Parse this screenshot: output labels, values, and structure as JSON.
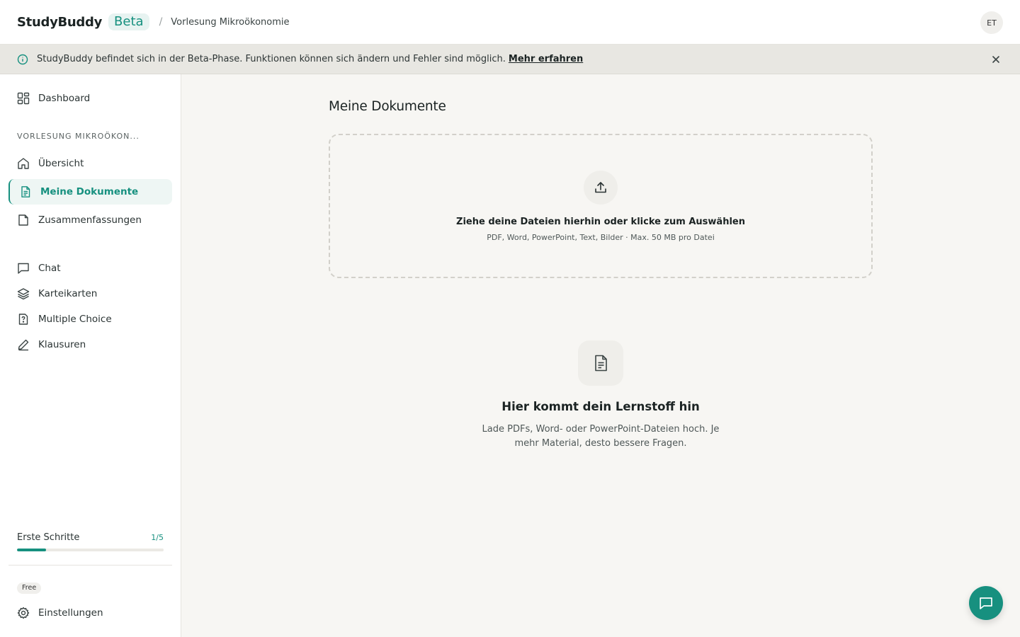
{
  "header": {
    "brand": "StudyBuddy",
    "beta": "Beta",
    "separator": "/",
    "breadcrumb": "Vorlesung Mikroökonomie",
    "avatar_initials": "ET"
  },
  "banner": {
    "text": "StudyBuddy befindet sich in der Beta-Phase. Funktionen können sich ändern und Fehler sind möglich.",
    "link": "Mehr erfahren"
  },
  "sidebar": {
    "dashboard": "Dashboard",
    "section_label": "VORLESUNG MIKROÖKON...",
    "items": [
      {
        "label": "Übersicht",
        "icon": "home-icon"
      },
      {
        "label": "Meine Dokumente",
        "icon": "document-icon",
        "active": true
      },
      {
        "label": "Zusammenfassungen",
        "icon": "file-icon"
      },
      {
        "label": "Chat",
        "icon": "chat-icon"
      },
      {
        "label": "Karteikarten",
        "icon": "layers-icon"
      },
      {
        "label": "Multiple Choice",
        "icon": "question-file-icon"
      },
      {
        "label": "Klausuren",
        "icon": "pencil-icon"
      }
    ],
    "progress": {
      "label": "Erste Schritte",
      "count": "1/5",
      "fraction": 0.2
    },
    "plan": "Free",
    "settings": "Einstellungen"
  },
  "main": {
    "title": "Meine Dokumente",
    "dropzone": {
      "title": "Ziehe deine Dateien hierhin oder klicke zum Auswählen",
      "subtitle": "PDF, Word, PowerPoint, Text, Bilder · Max. 50 MB pro Datei"
    },
    "empty": {
      "title": "Hier kommt dein Lernstoff hin",
      "text": "Lade PDFs, Word- oder PowerPoint-Dateien hoch. Je mehr Material, desto bessere Fragen."
    }
  },
  "colors": {
    "accent": "#16907f",
    "background": "#f7f6f3",
    "banner": "#e8e7e2"
  }
}
